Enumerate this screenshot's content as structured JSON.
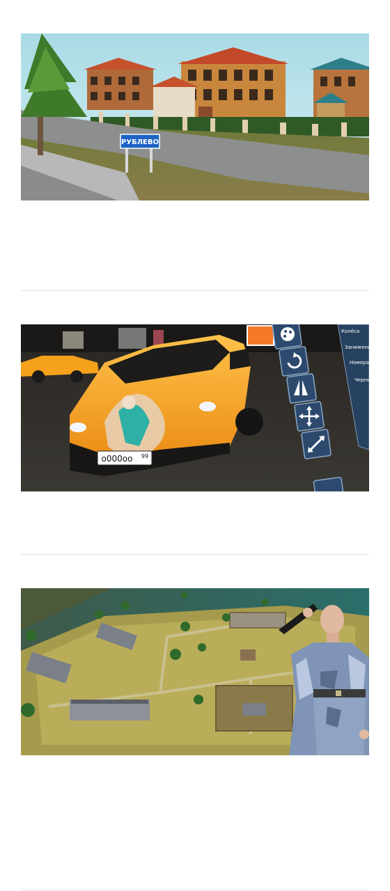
{
  "cards": [
    {
      "image": "village-street-scene",
      "sign_text": "РУБЛЕВО"
    },
    {
      "image": "orange-supercar-tuning",
      "plate_text": "o000oo",
      "plate_region": "99",
      "menu_items": [
        "Колёса",
        "Занижение",
        "Номера",
        "Черный"
      ],
      "tool_icons": [
        "palette-icon",
        "rotate-icon",
        "mirror-icon",
        "move-icon",
        "resize-icon"
      ]
    },
    {
      "image": "prison-map-with-guard"
    }
  ],
  "colors": {
    "divider": "#e2e2e2",
    "sky": "#bfe3e8",
    "car": "#f4a21c",
    "sign": "#1d63c6",
    "tool_button": "#2d4a6e"
  }
}
